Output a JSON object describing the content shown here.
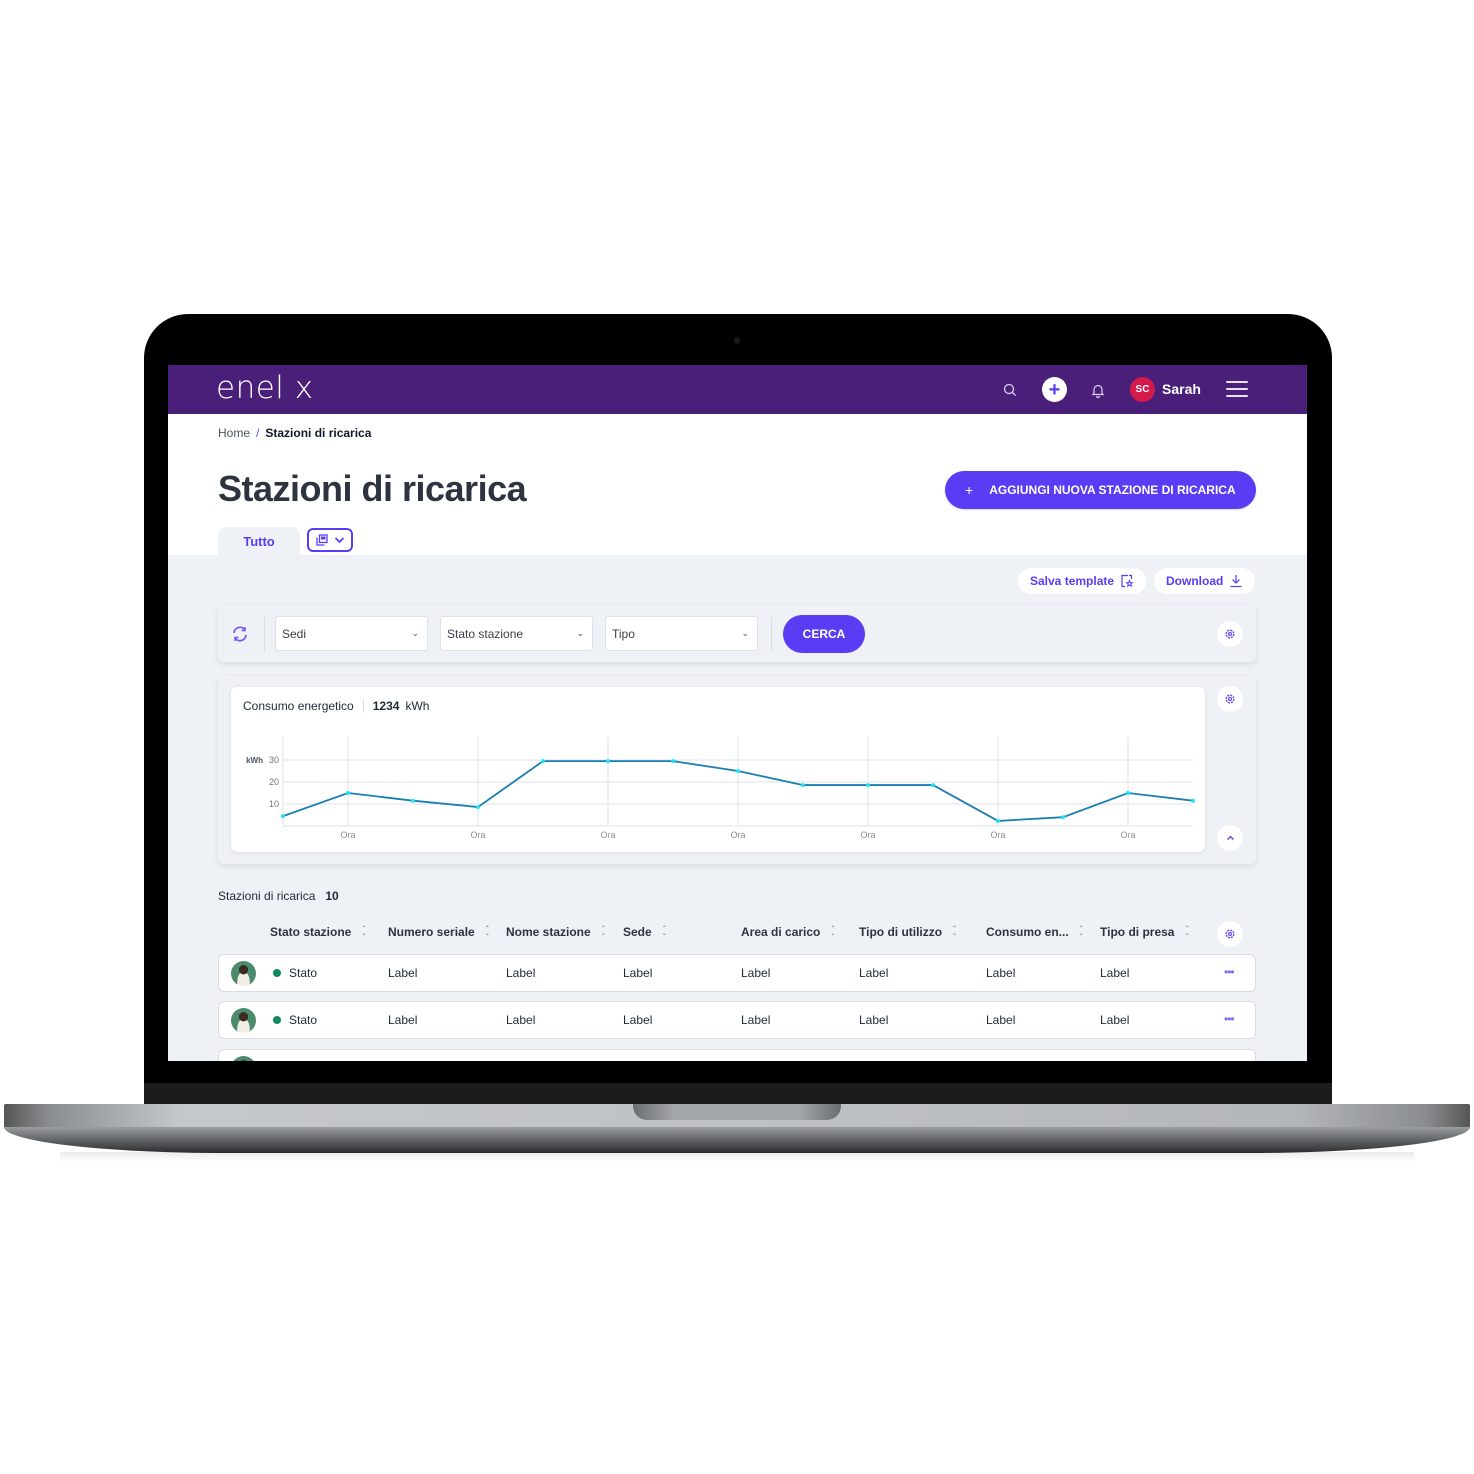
{
  "app": {
    "logo": "enel x",
    "brand_color": "#4a1f7a",
    "accent_color": "#5b3cf5"
  },
  "topbar": {
    "search_icon": "search-icon",
    "add_icon": "plus-icon",
    "notifications_icon": "bell-icon",
    "user_initials": "SC",
    "user_name": "Sarah",
    "menu_icon": "hamburger-icon"
  },
  "breadcrumb": {
    "home": "Home",
    "separator": "/",
    "current": "Stazioni di ricarica"
  },
  "page": {
    "title": "Stazioni di ricarica",
    "add_button": "AGGIUNGI NUOVA STAZIONE DI RICARICA",
    "add_button_icon": "+"
  },
  "tabs": {
    "active": "Tutto"
  },
  "actions": {
    "save_template": "Salva template",
    "download": "Download"
  },
  "filters": {
    "sedi": "Sedi",
    "stato": "Stato stazione",
    "tipo": "Tipo",
    "search_button": "CERCA",
    "chevron": "⌄"
  },
  "chart_data": {
    "type": "line",
    "title": "Consumo energetico",
    "total_value": "1234",
    "total_unit": "kWh",
    "ylabel": "kWh",
    "ylim": [
      0,
      38
    ],
    "yticks": [
      10,
      20,
      30
    ],
    "xtick_label": "Ora",
    "x": [
      0,
      1,
      2,
      3,
      4,
      5,
      6,
      7,
      8,
      9,
      10,
      11,
      12,
      13,
      14
    ],
    "xticks": [
      1,
      3,
      5,
      7,
      9,
      11,
      13
    ],
    "values": [
      4.5,
      15,
      11.5,
      8.6,
      29.5,
      29.5,
      29.5,
      25,
      18.6,
      18.6,
      18.6,
      2.3,
      4,
      15,
      11.5
    ],
    "grid": true,
    "line_color": "#1a7fb0",
    "marker_color": "#1ee6f0"
  },
  "table": {
    "title": "Stazioni di ricarica",
    "count": "10",
    "columns": [
      "Stato stazione",
      "Numero seriale",
      "Nome stazione",
      "Sede",
      "Area di carico",
      "Tipo di utilizzo",
      "Consumo en...",
      "Tipo di presa"
    ],
    "rows": [
      [
        "Stato",
        "Label",
        "Label",
        "Label",
        "Label",
        "Label",
        "Label",
        "Label"
      ],
      [
        "Stato",
        "Label",
        "Label",
        "Label",
        "Label",
        "Label",
        "Label",
        "Label"
      ]
    ],
    "status_color": "#0f8a5b",
    "more_icon": "•••"
  }
}
